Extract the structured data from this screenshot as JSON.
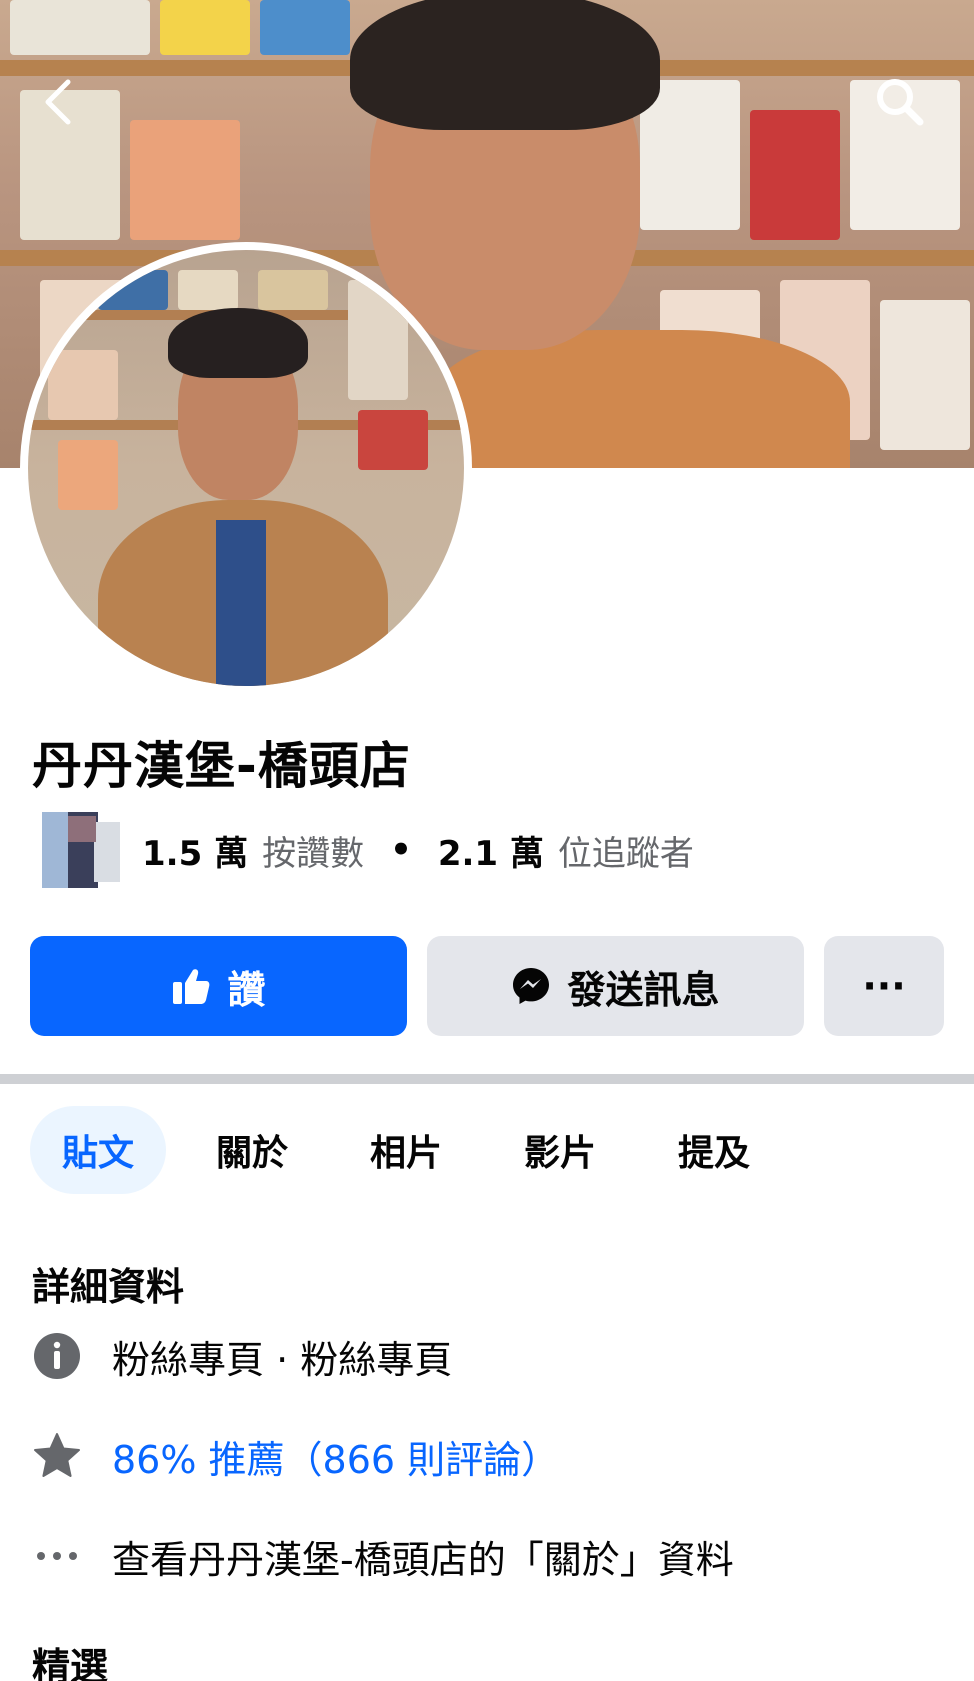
{
  "colors": {
    "primary": "#0866ff",
    "secondary_button": "#e4e6eb",
    "muted_text": "#65676b",
    "active_tab_bg": "#ebf5ff"
  },
  "header": {
    "back_icon": "chevron-left-icon",
    "search_icon": "search-icon"
  },
  "page": {
    "title": "丹丹漢堡-橋頭店"
  },
  "stats": {
    "likes_count": "1.5 萬",
    "likes_label": "按讚數",
    "separator": "•",
    "followers_count": "2.1 萬",
    "followers_label": "位追蹤者"
  },
  "actions": {
    "like_label": "讚",
    "message_label": "發送訊息",
    "more_label": "···"
  },
  "tabs": [
    {
      "label": "貼文",
      "active": true
    },
    {
      "label": "關於",
      "active": false
    },
    {
      "label": "相片",
      "active": false
    },
    {
      "label": "影片",
      "active": false
    },
    {
      "label": "提及",
      "active": false
    }
  ],
  "details": {
    "title": "詳細資料",
    "category": "粉絲專頁 · 粉絲專頁",
    "rating": "86% 推薦（866 則評論）",
    "about_link": "查看丹丹漢堡-橋頭店的「關於」資料"
  },
  "featured": {
    "title": "精選"
  }
}
